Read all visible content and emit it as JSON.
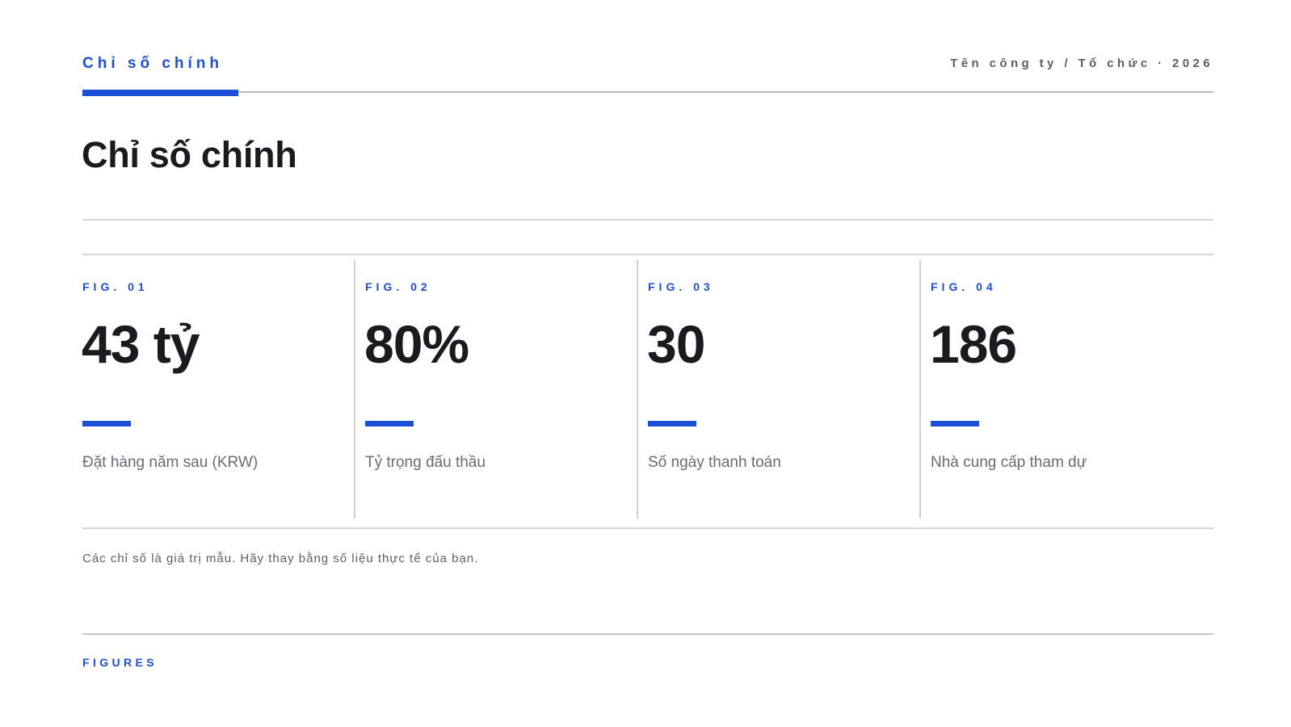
{
  "header": {
    "section_tag": "Chỉ số chính",
    "organization": "Tên công ty / Tổ chức · 2026"
  },
  "title": "Chỉ số chính",
  "metrics": [
    {
      "fig": "FIG. 01",
      "value": "43 tỷ",
      "label": "Đặt hàng năm sau (KRW)"
    },
    {
      "fig": "FIG. 02",
      "value": "80%",
      "label": "Tỷ trọng đấu thầu"
    },
    {
      "fig": "FIG. 03",
      "value": "30",
      "label": "Số ngày thanh toán"
    },
    {
      "fig": "FIG. 04",
      "value": "186",
      "label": "Nhà cung cấp tham dự"
    }
  ],
  "footnote": "Các chỉ số là giá trị mẫu. Hãy thay bằng số liệu thực tế của bạn.",
  "footer": {
    "tag": "FIGURES"
  },
  "colors": {
    "accent": "#1c4fd8",
    "text": "#1a1a1f",
    "muted": "#6b6b74",
    "rule": "#d6d6da"
  }
}
